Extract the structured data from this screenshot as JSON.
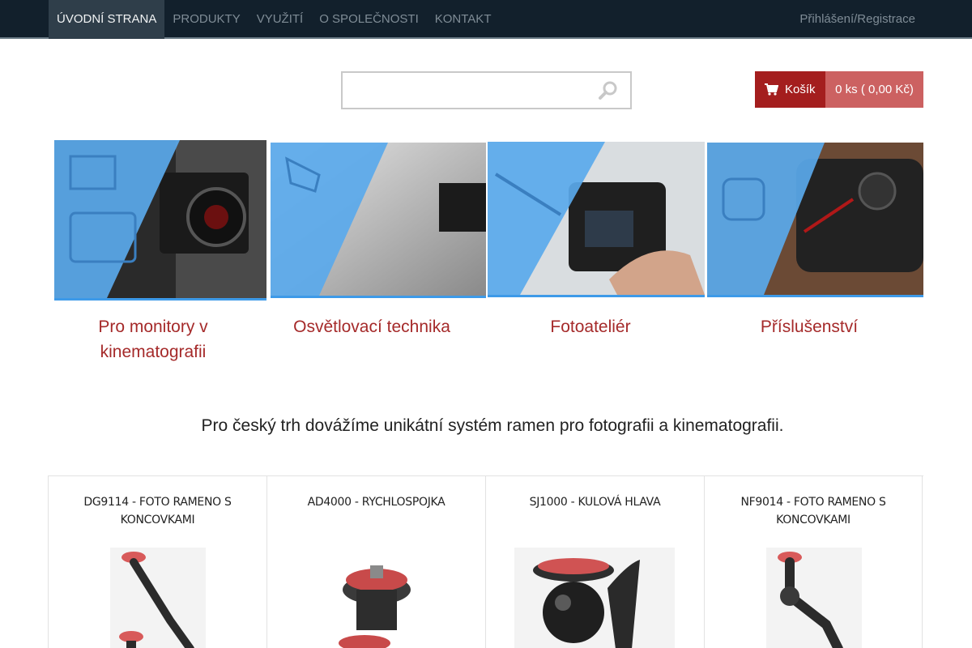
{
  "nav": {
    "items": [
      {
        "label": "Úvodní strana",
        "active": true
      },
      {
        "label": "Produkty"
      },
      {
        "label": "Využití"
      },
      {
        "label": "O společnosti"
      },
      {
        "label": "Kontakt"
      }
    ],
    "login_label": "Přihlášení/Registrace"
  },
  "search": {
    "value": "",
    "placeholder": ""
  },
  "cart": {
    "label": "Košík",
    "summary": "0 ks ( 0,00 Kč)"
  },
  "categories": [
    {
      "title": "Pro monitory v kinematografii"
    },
    {
      "title": "Osvětlovací technika"
    },
    {
      "title": "Fotoateliér"
    },
    {
      "title": "Příslušenství"
    }
  ],
  "tagline": "Pro český trh dovážíme unikátní systém ramen pro fotografii a kinematografii.",
  "products": [
    {
      "name": "DG9114 - foto rameno s koncovkami"
    },
    {
      "name": "AD4000 - rychlospojka"
    },
    {
      "name": "SJ1000 - kulová hlava"
    },
    {
      "name": "NF9014 - foto rameno s koncovkami"
    }
  ],
  "colors": {
    "nav_bg": "#12202c",
    "accent_red": "#a41e1e",
    "cart_light": "#cc6161",
    "category_blue": "#3d9ae8"
  }
}
